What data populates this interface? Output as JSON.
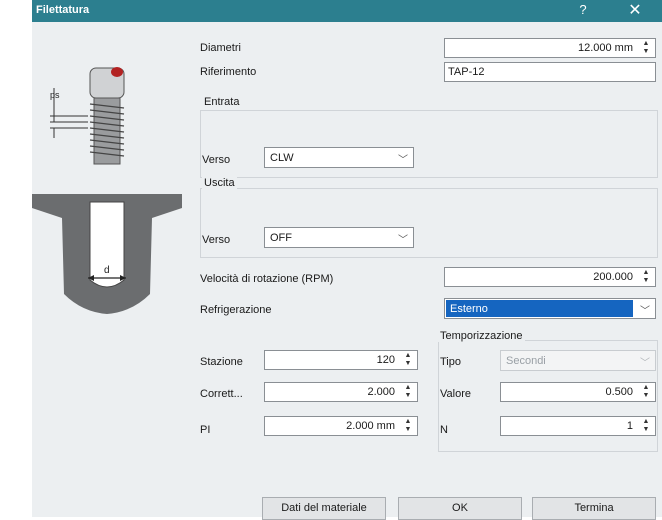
{
  "window": {
    "title": "Filettatura",
    "help_label": "?",
    "close_label": "✕"
  },
  "illustration": {
    "label_ps": "ps",
    "label_d": "d"
  },
  "diametri": {
    "label": "Diametri",
    "value": "12.000 mm"
  },
  "riferimento": {
    "label": "Riferimento",
    "value": "TAP-12"
  },
  "entrata": {
    "title": "Entrata",
    "verso_label": "Verso",
    "verso_value": "CLW"
  },
  "uscita": {
    "title": "Uscita",
    "verso_label": "Verso",
    "verso_value": "OFF"
  },
  "velocita": {
    "label": "Velocità di rotazione (RPM)",
    "value": "200.000"
  },
  "refrigerazione": {
    "label": "Refrigerazione",
    "value": "Esterno"
  },
  "stazione": {
    "label": "Stazione",
    "value": "120"
  },
  "correttore": {
    "label": "Corrett...",
    "value": "2.000"
  },
  "pi": {
    "label": "PI",
    "value": "2.000 mm"
  },
  "temporizzazione": {
    "title": "Temporizzazione",
    "tipo_label": "Tipo",
    "tipo_value": "Secondi",
    "valore_label": "Valore",
    "valore_value": "0.500",
    "n_label": "N",
    "n_value": "1"
  },
  "buttons": {
    "dati_materiale": "Dati del materiale",
    "ok": "OK",
    "termina": "Termina"
  },
  "colors": {
    "titlebar": "#2c7f8f",
    "selection": "#1565c0",
    "dialog_bg": "#eceff1"
  }
}
